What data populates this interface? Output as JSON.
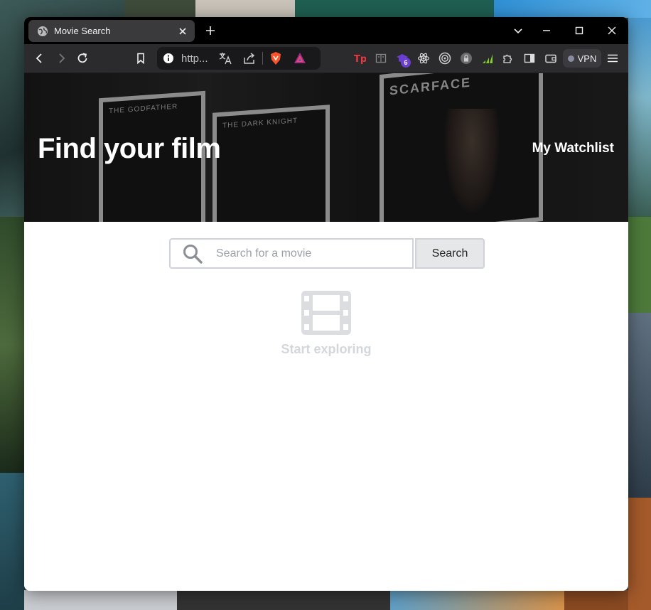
{
  "browser": {
    "tab_title": "Movie Search",
    "url_display": "http...",
    "vpn_label": "VPN",
    "extension_badge": "6"
  },
  "hero": {
    "title": "Find your film",
    "watchlist_label": "My Watchlist",
    "poster_titles": [
      "THE GODFATHER",
      "THE DARK KNIGHT",
      "SCARFACE"
    ]
  },
  "search": {
    "placeholder": "Search for a movie",
    "value": "",
    "button_label": "Search"
  },
  "empty_state": {
    "label": "Start exploring",
    "icon": "film-icon"
  }
}
